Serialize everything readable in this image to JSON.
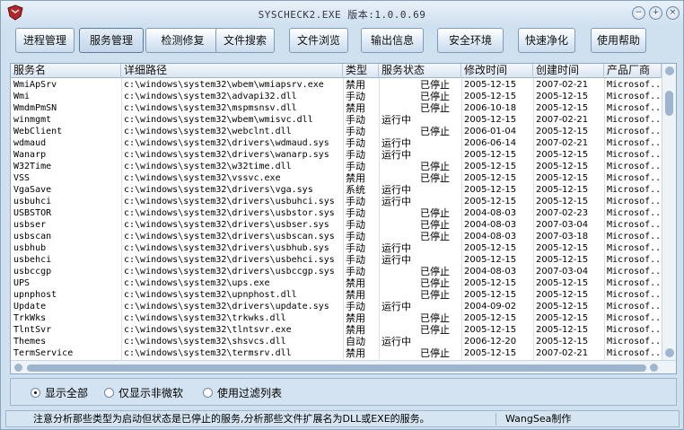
{
  "window": {
    "title": "SYSCHECK2.EXE  版本:1.0.0.69"
  },
  "toolbar": {
    "buttons": [
      {
        "label": "进程管理"
      },
      {
        "label": "服务管理"
      },
      {
        "label": "检测修复"
      },
      {
        "label": "文件搜索"
      },
      {
        "label": "文件浏览"
      },
      {
        "label": "输出信息"
      },
      {
        "label": "安全环境"
      },
      {
        "label": "快速净化"
      },
      {
        "label": "使用帮助"
      }
    ],
    "active_index": 1
  },
  "table": {
    "columns": [
      "服务名",
      "详细路径",
      "类型",
      "服务状态",
      "修改时间",
      "创建时间",
      "产品厂商"
    ],
    "rows": [
      [
        "WmiApSrv",
        "c:\\windows\\system32\\wbem\\wmiapsrv.exe",
        "禁用",
        "已停止",
        "2005-12-15",
        "2007-02-21",
        "Microsof..."
      ],
      [
        "Wmi",
        "c:\\windows\\system32\\advapi32.dll",
        "手动",
        "已停止",
        "2005-12-15",
        "2005-12-15",
        "Microsof..."
      ],
      [
        "WmdmPmSN",
        "c:\\windows\\system32\\mspmsnsv.dll",
        "禁用",
        "已停止",
        "2006-10-18",
        "2005-12-15",
        "Microsof..."
      ],
      [
        "winmgmt",
        "c:\\windows\\system32\\wbem\\wmisvc.dll",
        "手动",
        "运行中",
        "2005-12-15",
        "2007-02-21",
        "Microsof..."
      ],
      [
        "WebClient",
        "c:\\windows\\system32\\webclnt.dll",
        "手动",
        "已停止",
        "2006-01-04",
        "2005-12-15",
        "Microsof..."
      ],
      [
        "wdmaud",
        "c:\\windows\\system32\\drivers\\wdmaud.sys",
        "手动",
        "运行中",
        "2006-06-14",
        "2007-02-21",
        "Microsof..."
      ],
      [
        "Wanarp",
        "c:\\windows\\system32\\drivers\\wanarp.sys",
        "手动",
        "运行中",
        "2005-12-15",
        "2005-12-15",
        "Microsof..."
      ],
      [
        "W32Time",
        "c:\\windows\\system32\\w32time.dll",
        "手动",
        "已停止",
        "2005-12-15",
        "2005-12-15",
        "Microsof..."
      ],
      [
        "VSS",
        "c:\\windows\\system32\\vssvc.exe",
        "禁用",
        "已停止",
        "2005-12-15",
        "2005-12-15",
        "Microsof..."
      ],
      [
        "VgaSave",
        "c:\\windows\\system32\\drivers\\vga.sys",
        "系统",
        "运行中",
        "2005-12-15",
        "2005-12-15",
        "Microsof..."
      ],
      [
        "usbuhci",
        "c:\\windows\\system32\\drivers\\usbuhci.sys",
        "手动",
        "运行中",
        "2005-12-15",
        "2005-12-15",
        "Microsof..."
      ],
      [
        "USBSTOR",
        "c:\\windows\\system32\\drivers\\usbstor.sys",
        "手动",
        "已停止",
        "2004-08-03",
        "2007-02-23",
        "Microsof..."
      ],
      [
        "usbser",
        "c:\\windows\\system32\\drivers\\usbser.sys",
        "手动",
        "已停止",
        "2004-08-03",
        "2007-03-04",
        "Microsof..."
      ],
      [
        "usbscan",
        "c:\\windows\\system32\\drivers\\usbscan.sys",
        "手动",
        "已停止",
        "2004-08-03",
        "2007-03-18",
        "Microsof..."
      ],
      [
        "usbhub",
        "c:\\windows\\system32\\drivers\\usbhub.sys",
        "手动",
        "运行中",
        "2005-12-15",
        "2005-12-15",
        "Microsof..."
      ],
      [
        "usbehci",
        "c:\\windows\\system32\\drivers\\usbehci.sys",
        "手动",
        "运行中",
        "2005-12-15",
        "2005-12-15",
        "Microsof..."
      ],
      [
        "usbccgp",
        "c:\\windows\\system32\\drivers\\usbccgp.sys",
        "手动",
        "已停止",
        "2004-08-03",
        "2007-03-04",
        "Microsof..."
      ],
      [
        "UPS",
        "c:\\windows\\system32\\ups.exe",
        "禁用",
        "已停止",
        "2005-12-15",
        "2005-12-15",
        "Microsof..."
      ],
      [
        "upnphost",
        "c:\\windows\\system32\\upnphost.dll",
        "禁用",
        "已停止",
        "2005-12-15",
        "2005-12-15",
        "Microsof..."
      ],
      [
        "Update",
        "c:\\windows\\system32\\drivers\\update.sys",
        "手动",
        "运行中",
        "2004-09-02",
        "2005-12-15",
        "Microsof..."
      ],
      [
        "TrkWks",
        "c:\\windows\\system32\\trkwks.dll",
        "禁用",
        "已停止",
        "2005-12-15",
        "2005-12-15",
        "Microsof..."
      ],
      [
        "TlntSvr",
        "c:\\windows\\system32\\tlntsvr.exe",
        "禁用",
        "已停止",
        "2005-12-15",
        "2005-12-15",
        "Microsof..."
      ],
      [
        "Themes",
        "c:\\windows\\system32\\shsvcs.dll",
        "自动",
        "运行中",
        "2006-12-20",
        "2005-12-15",
        "Microsof..."
      ],
      [
        "TermService",
        "c:\\windows\\system32\\termsrv.dll",
        "禁用",
        "已停止",
        "2005-12-15",
        "2007-02-21",
        "Microsof..."
      ]
    ]
  },
  "filters": {
    "options": [
      "显示全部",
      "仅显示非微软",
      "使用过滤列表"
    ],
    "selected_index": 0
  },
  "status": {
    "hint": "注意分析那些类型为启动但状态是已停止的服务,分析那些文件扩展名为DLL或EXE的服务。",
    "author": "WangSea制作"
  }
}
